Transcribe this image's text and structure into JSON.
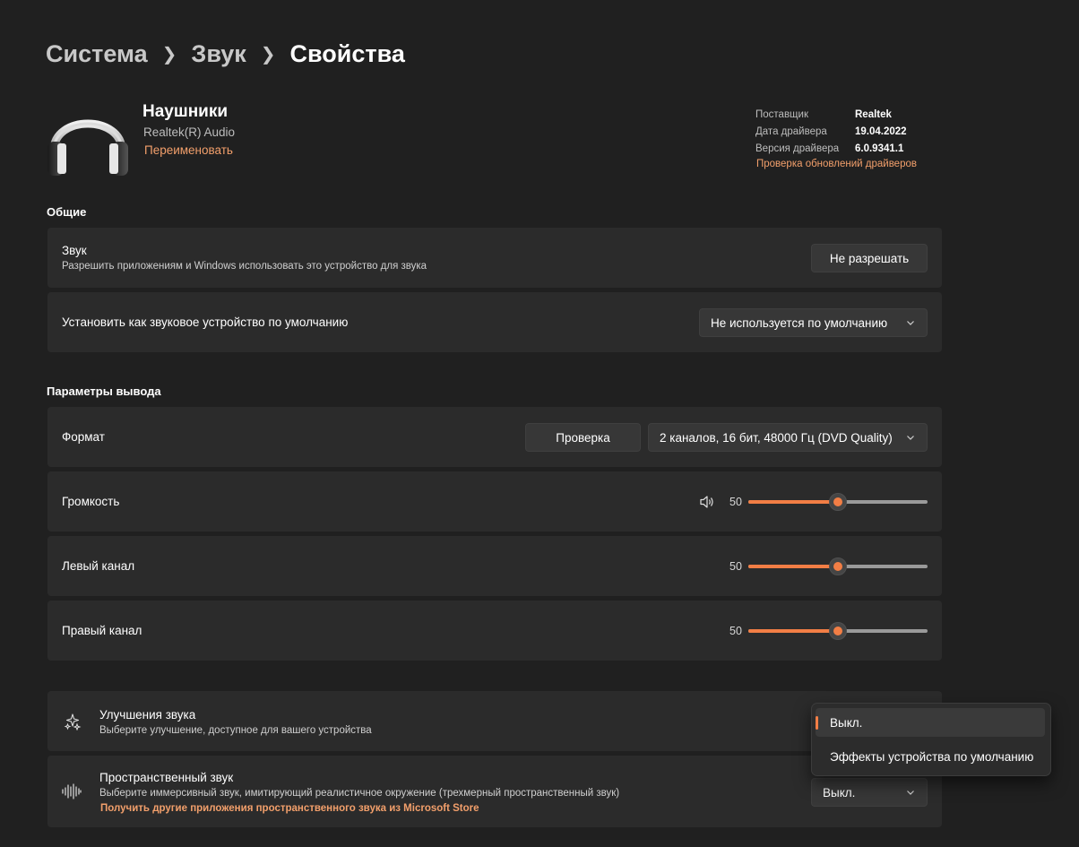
{
  "breadcrumb": {
    "level1": "Система",
    "level2": "Звук",
    "current": "Свойства"
  },
  "device": {
    "name": "Наушники",
    "subtitle": "Realtek(R) Audio",
    "rename": "Переименовать"
  },
  "driver": {
    "rows": [
      {
        "key": "Поставщик",
        "value": "Realtek"
      },
      {
        "key": "Дата драйвера",
        "value": "19.04.2022"
      },
      {
        "key": "Версия драйвера",
        "value": "6.0.9341.1"
      }
    ],
    "update_link": "Проверка обновлений драйверов"
  },
  "general": {
    "title": "Общие",
    "audio": {
      "title": "Звук",
      "desc": "Разрешить приложениям и Windows использовать это устройство для звука",
      "button": "Не разрешать"
    },
    "default": {
      "title": "Установить как звуковое устройство по умолчанию",
      "select": "Не используется по умолчанию"
    }
  },
  "output": {
    "title": "Параметры вывода",
    "format": {
      "title": "Формат",
      "test_button": "Проверка",
      "select": "2 каналов, 16 бит, 48000 Гц (DVD Quality)"
    },
    "volume": {
      "title": "Громкость",
      "value": "50",
      "level": 0.5
    },
    "left": {
      "title": "Левый канал",
      "value": "50",
      "level": 0.5
    },
    "right": {
      "title": "Правый канал",
      "value": "50",
      "level": 0.5
    }
  },
  "enhancements": {
    "title": "Улучшения звука",
    "desc": "Выберите улучшение, доступное для вашего устройства",
    "options": [
      "Выкл.",
      "Эффекты устройства по умолчанию"
    ],
    "selected_index": 0
  },
  "spatial": {
    "title": "Пространственный звук",
    "desc": "Выберите иммерсивный звук, имитирующий реалистичное окружение (трехмерный пространственный звук)",
    "store_link": "Получить другие приложения пространственного звука из Microsoft Store",
    "select": "Выкл."
  },
  "colors": {
    "accent": "#f27e45",
    "link": "#f29f6b",
    "background": "#202020",
    "card": "#2b2b2b"
  },
  "icons": [
    "chevron-right-icon",
    "headphones-icon",
    "chevron-down-icon",
    "speaker-icon",
    "sparkle-icon",
    "spatial-sound-icon"
  ]
}
